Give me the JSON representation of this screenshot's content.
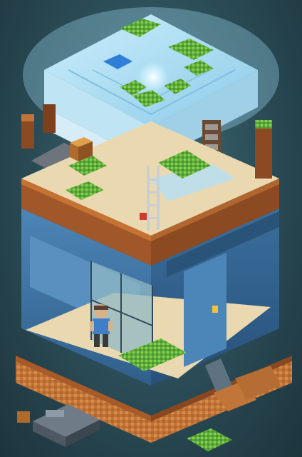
{
  "scene": {
    "type": "isometric voxel diorama",
    "palette": {
      "background": "#2f5560",
      "roof_ice": "#a9d9f0",
      "roof_glow": "#dff6ff",
      "wall_blue": "#3f76a6",
      "wall_blue_dark": "#2b5680",
      "dirt_brown": "#a0582a",
      "dirt_dark": "#6e3a1a",
      "floor_sand": "#ead9b0",
      "grass": "#5fae3a",
      "grass_light": "#8fd45a",
      "brick_orange": "#c97a3c",
      "stone_gray": "#7d8791",
      "glass": "#8fb8c4"
    },
    "objects": [
      "roof-block",
      "upper-floor",
      "lower-room",
      "glass-partition",
      "door",
      "character",
      "ladder",
      "brick-base",
      "rubble-vehicle",
      "grass-patch"
    ]
  }
}
